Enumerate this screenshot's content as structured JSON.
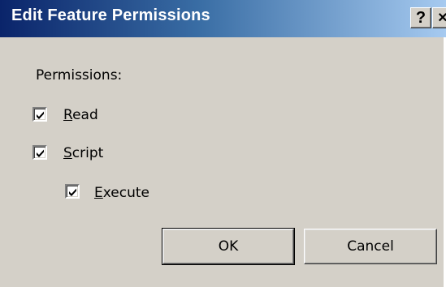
{
  "dialog": {
    "title": "Edit Feature Permissions",
    "help_button": "?",
    "close_button": "×"
  },
  "permissions": {
    "group_label": "Permissions:",
    "read": {
      "label": "Read",
      "access_key": "R",
      "rest": "ead",
      "checked": true
    },
    "script": {
      "label": "Script",
      "access_key": "S",
      "rest": "cript",
      "checked": true
    },
    "execute": {
      "label": "Execute",
      "access_key": "E",
      "rest": "xecute",
      "checked": true
    }
  },
  "buttons": {
    "ok_label": "OK",
    "cancel_label": "Cancel"
  },
  "colors": {
    "titlebar_start": "#0a246a",
    "titlebar_end": "#a6caf0",
    "dialog_face": "#d4d0c8"
  }
}
